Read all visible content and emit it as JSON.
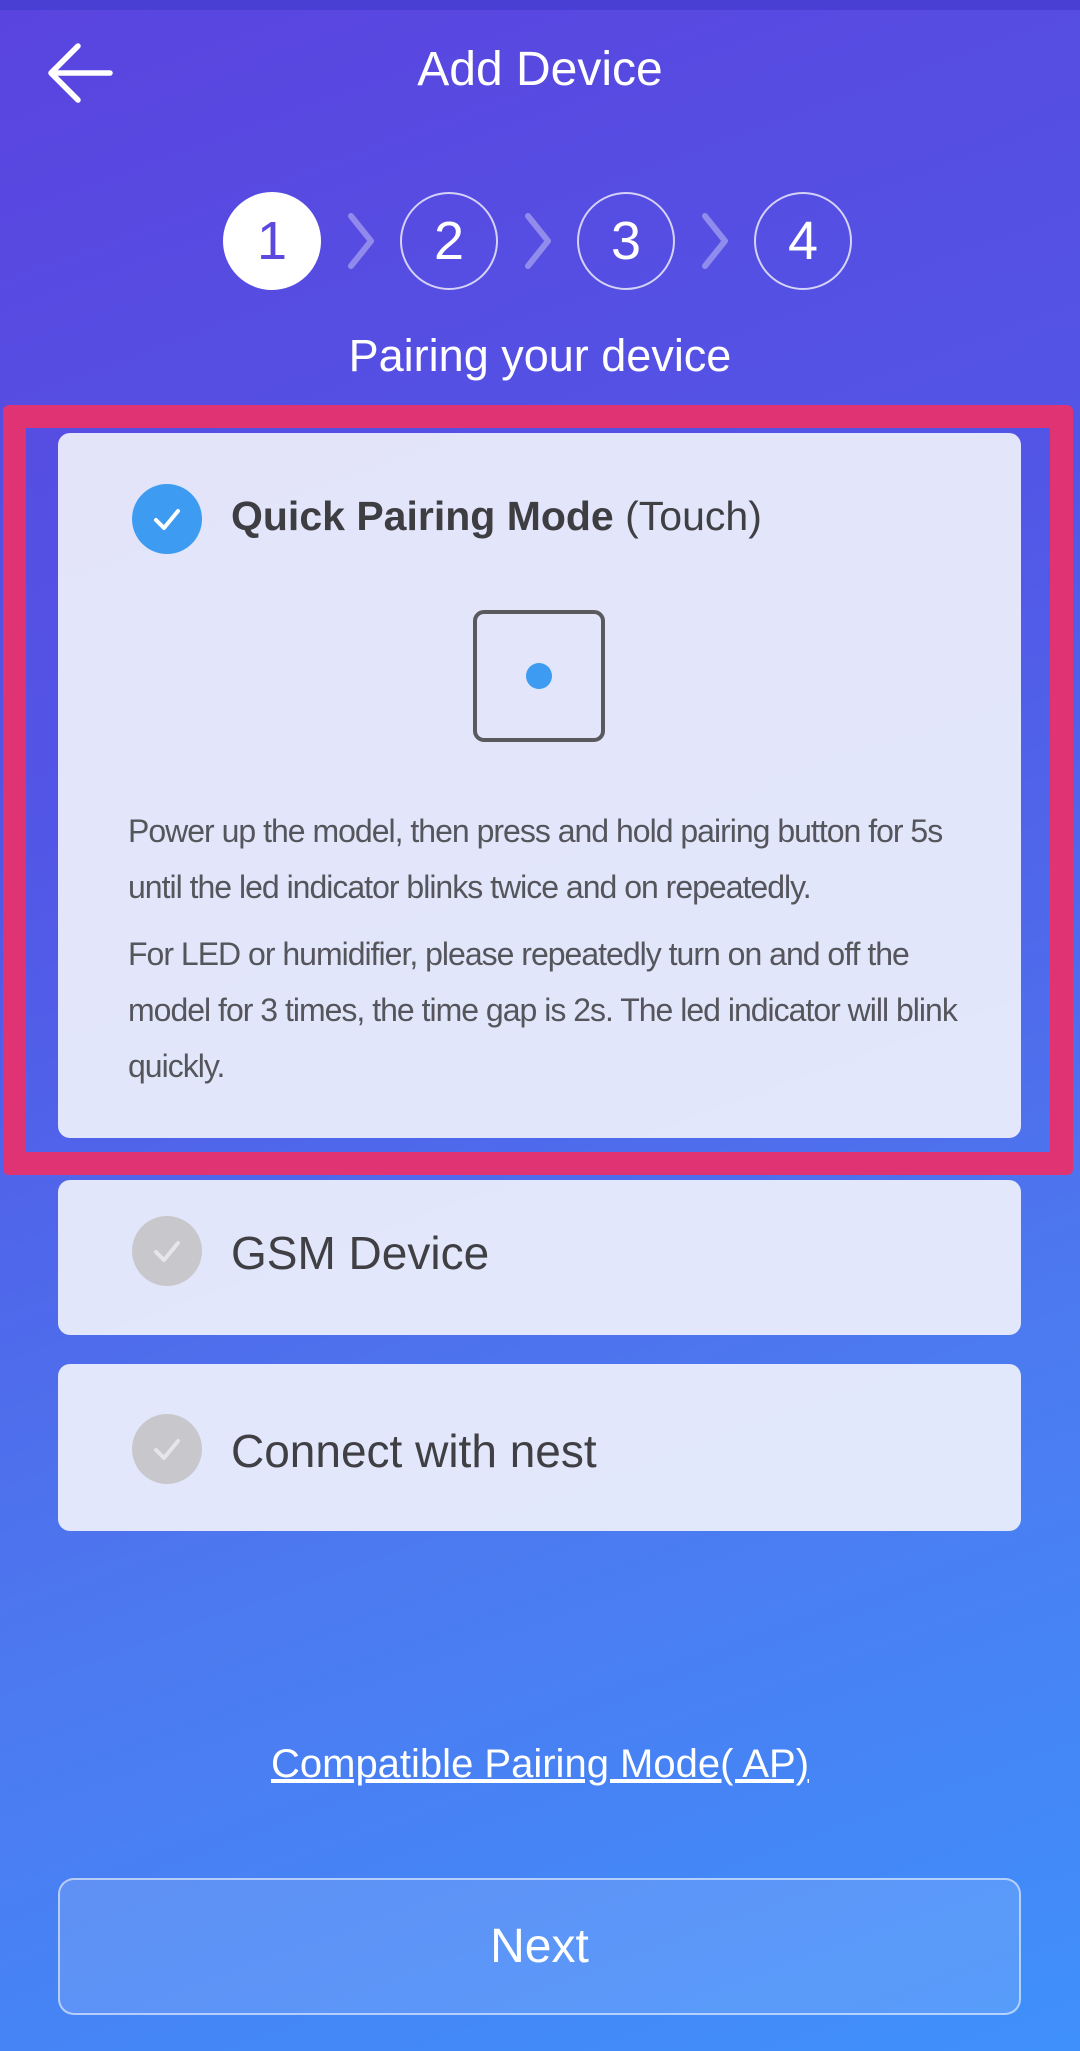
{
  "header": {
    "title": "Add Device",
    "back_icon": "arrow-left-icon"
  },
  "steps": {
    "items": [
      "1",
      "2",
      "3",
      "4"
    ],
    "current": "1"
  },
  "subtitle": "Pairing your device",
  "options": {
    "quick": {
      "title": "Quick Pairing Mode",
      "suffix": "(Touch)",
      "selected": true,
      "description_1": "Power up the model, then press and hold pairing button for 5s until the led indicator blinks twice and on repeatedly.",
      "description_2": "For LED or humidifier, please repeatedly turn on and off the model for 3 times, the time gap is 2s. The led indicator will blink quickly."
    },
    "gsm": {
      "title": "GSM Device",
      "selected": false
    },
    "nest": {
      "title": "Connect with nest",
      "selected": false
    }
  },
  "compat_link": "Compatible Pairing Mode( AP)",
  "next_button": "Next",
  "colors": {
    "accent": "#3d9cf1",
    "highlight": "#e03374",
    "bg_start": "#5a44df",
    "bg_end": "#3f90fb"
  }
}
